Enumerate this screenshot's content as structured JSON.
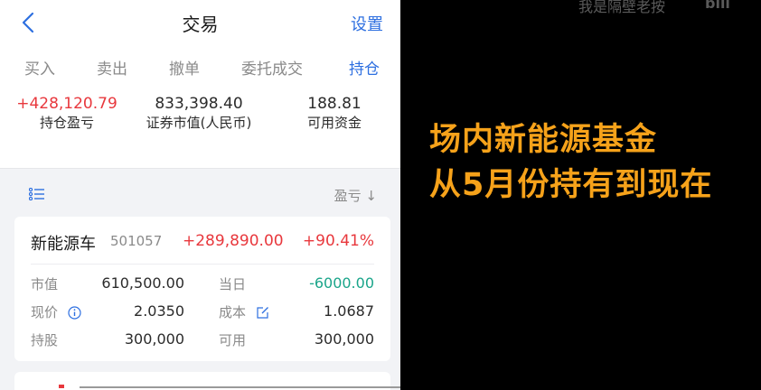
{
  "header": {
    "title": "交易",
    "settings_label": "设置"
  },
  "tabs": [
    {
      "label": "买入"
    },
    {
      "label": "卖出"
    },
    {
      "label": "撤单"
    },
    {
      "label": "委托成交"
    },
    {
      "label": "持仓"
    }
  ],
  "summary": {
    "pnl_value": "+428,120.79",
    "pnl_label": "持仓盈亏",
    "market_value": "833,398.40",
    "market_label": "证券市值(人民币)",
    "cash_value": "188.81",
    "cash_label": "可用资金"
  },
  "list": {
    "sort_label": "盈亏 ↓"
  },
  "holding": {
    "name": "新能源车",
    "code": "501057",
    "pnl": "+289,890.00",
    "pnl_pct": "+90.41%",
    "market_value_label": "市值",
    "market_value": "610,500.00",
    "today_label": "当日",
    "today": "-6000.00",
    "price_label": "现价",
    "price": "2.0350",
    "cost_label": "成本",
    "cost": "1.0687",
    "shares_label": "持股",
    "shares": "300,000",
    "available_label": "可用",
    "available": "300,000"
  },
  "overlay": {
    "watermark": "我是隔壁老按",
    "watermark_logo": "bili",
    "caption_line1": "场内新能源基金",
    "caption_line2": "从5月份持有到现在"
  },
  "colors": {
    "accent": "#2d6fe0",
    "up": "#e8383d",
    "down": "#1aa58a",
    "caption": "#f6a21a"
  }
}
